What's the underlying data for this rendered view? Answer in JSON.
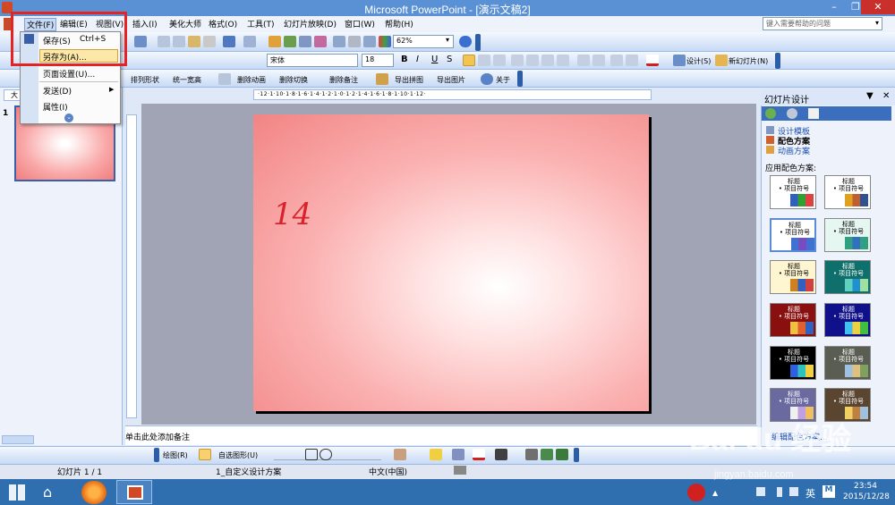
{
  "window": {
    "title": "Microsoft PowerPoint - [演示文稿2]",
    "min": "–",
    "max": "❐",
    "close": "✕"
  },
  "menubar": {
    "items": [
      "文件(F)",
      "编辑(E)",
      "视图(V)",
      "插入(I)",
      "美化大师",
      "格式(O)",
      "工具(T)",
      "幻灯片放映(D)",
      "窗口(W)",
      "帮助(H)"
    ],
    "help_placeholder": "键入需要帮助的问题"
  },
  "file_menu": {
    "save_label": "保存(S)",
    "save_shortcut": "Ctrl+S",
    "save_as_label": "另存为(A)...",
    "page_setup_label": "页面设置(U)...",
    "send_label": "发送(D)",
    "send_arrow": "▶",
    "properties_label": "属性(I)",
    "expand": "⌄"
  },
  "toolbar1": {
    "zoom": "62%"
  },
  "toolbar2": {
    "font": "宋体",
    "size": "18",
    "bold": "B",
    "italic": "I",
    "underline": "U",
    "shadow": "S",
    "design": "设计(S)",
    "new_slide": "新幻灯片(N)"
  },
  "toolbar3": {
    "items": [
      "排列形状",
      "统一宽高",
      "删除动画",
      "删除切换",
      "删除备注",
      "导出拼图",
      "导出图片",
      "关于"
    ]
  },
  "left_panel": {
    "tab_label": "大",
    "slide_number": "1"
  },
  "ruler": {
    "text": "·12·1·10·1·8·1·6·1·4·1·2·1·0·1·2·1·4·1·6·1·8·1·10·1·12·"
  },
  "slide": {
    "handwritten": "14"
  },
  "task_pane": {
    "title": "幻灯片设计",
    "links": [
      "设计模板",
      "配色方案",
      "动画方案"
    ],
    "section_label": "应用配色方案:",
    "scheme_title": "标题",
    "scheme_bullet": "• 项目符号",
    "bottom_link": "编辑配色方案..."
  },
  "notes": {
    "placeholder": "单击此处添加备注"
  },
  "draw_toolbar": {
    "draw_label": "绘图(R)",
    "autoshapes_label": "自选图形(U)"
  },
  "status": {
    "slide_info": "幻灯片 1 / 1",
    "design": "1_自定义设计方案",
    "language": "中文(中国)"
  },
  "taskbar": {
    "time": "23:54",
    "date": "2015/12/28",
    "ime": "英"
  },
  "watermark": {
    "main": "Bai du 经验",
    "url": "jingyan.baidu.com"
  },
  "colors": {
    "accent": "#2f6fb0",
    "highlight_frame": "#e52323",
    "slide_edge": "#f28484"
  }
}
